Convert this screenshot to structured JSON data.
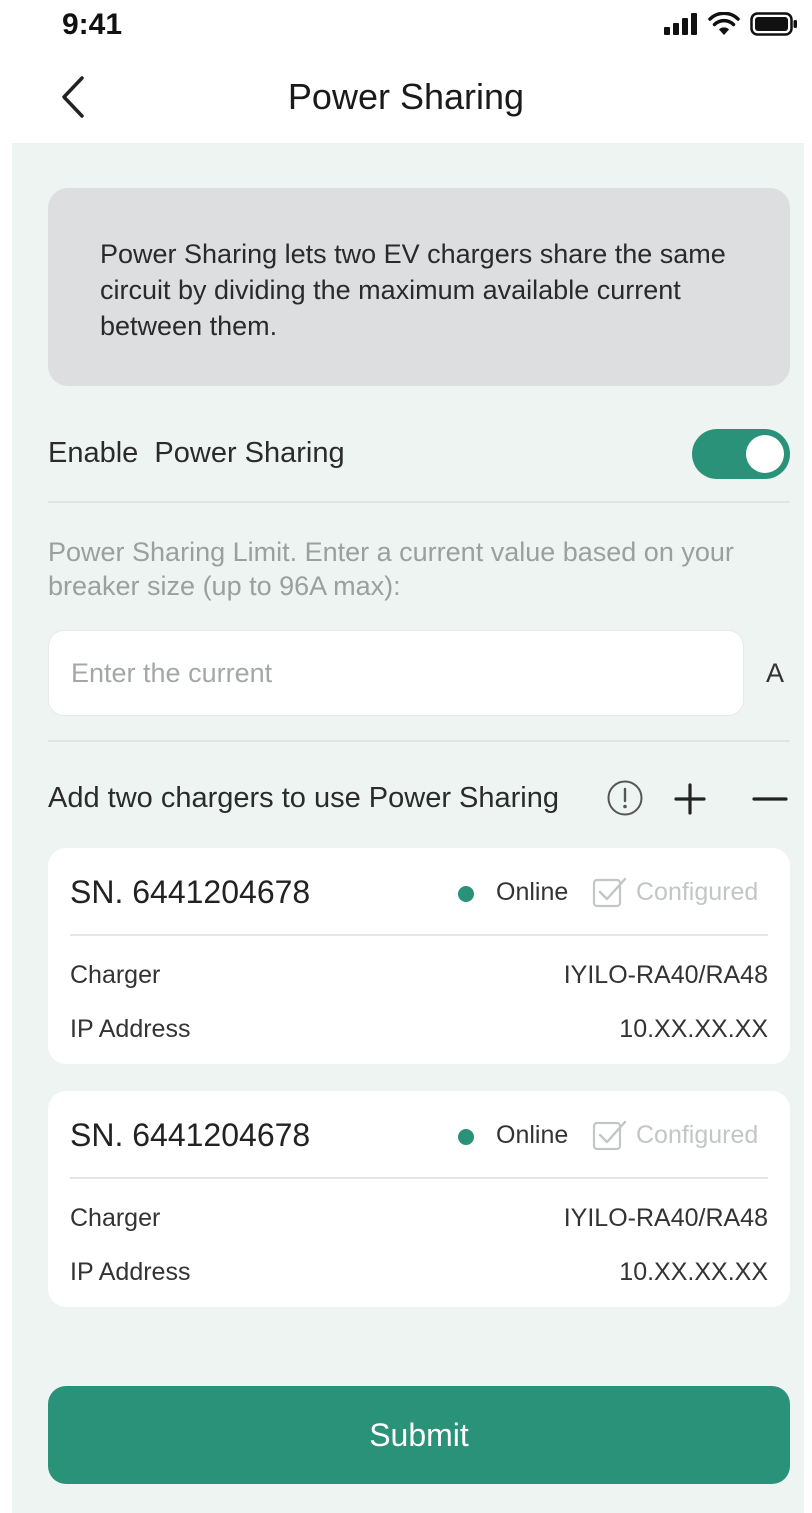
{
  "status_bar": {
    "time": "9:41"
  },
  "nav": {
    "title": "Power Sharing"
  },
  "info": {
    "description": "Power Sharing lets two EV chargers share the same circuit by dividing the maximum available current between them."
  },
  "enable": {
    "label": "Enable  Power Sharing",
    "on": true
  },
  "limit": {
    "text": "Power Sharing Limit. Enter a current value based on your breaker size (up to 96A max):",
    "placeholder": "Enter the current",
    "value": "",
    "unit": "A"
  },
  "chargers_section": {
    "label": "Add two chargers to use Power Sharing"
  },
  "chargers": [
    {
      "sn": "SN. 6441204678",
      "status": "Online",
      "config": "Configured",
      "charger_label": "Charger",
      "charger_value": "IYILO-RA40/RA48",
      "ip_label": "IP Address",
      "ip_value": "10.XX.XX.XX"
    },
    {
      "sn": "SN. 6441204678",
      "status": "Online",
      "config": "Configured",
      "charger_label": "Charger",
      "charger_value": "IYILO-RA40/RA48",
      "ip_label": "IP Address",
      "ip_value": "10.XX.XX.XX"
    }
  ],
  "submit": {
    "label": "Submit"
  },
  "colors": {
    "accent": "#2a9279",
    "background": "#eef4f1",
    "info_box": "#dcdee0",
    "muted_text": "#9aa09d"
  },
  "icons": [
    "back-chevron-icon",
    "signal-icon",
    "wifi-icon",
    "battery-icon",
    "info-icon",
    "plus-icon",
    "minus-icon",
    "configured-check-icon"
  ]
}
